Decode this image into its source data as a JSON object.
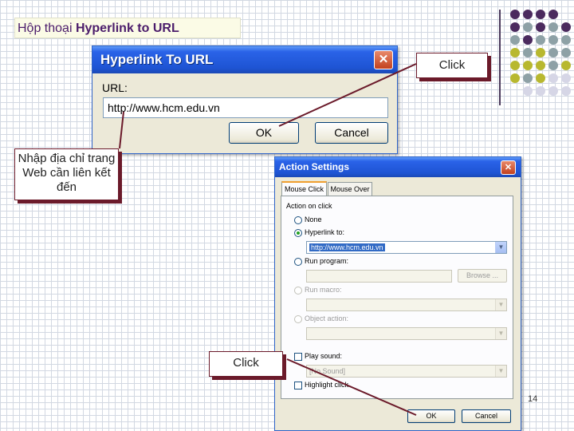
{
  "slide": {
    "title_prefix": "Hộp thoại ",
    "title_bold": "Hyperlink to URL",
    "page_number": "14"
  },
  "hyperlink_dialog": {
    "title": "Hyperlink To URL",
    "close_icon": "close-icon",
    "url_label": "URL:",
    "url_value": "http://www.hcm.edu.vn",
    "ok_label": "OK",
    "cancel_label": "Cancel"
  },
  "action_dialog": {
    "title": "Action Settings",
    "close_icon": "close-icon",
    "tabs": [
      {
        "label": "Mouse Click",
        "active": true
      },
      {
        "label": "Mouse Over",
        "active": false
      }
    ],
    "group_label": "Action on click",
    "options": {
      "none": "None",
      "hyperlink": "Hyperlink to:",
      "run_program": "Run program:",
      "run_macro": "Run macro:",
      "object_action": "Object action:"
    },
    "selected_option": "hyperlink",
    "hyperlink_value": "http://www.hcm.edu.vn",
    "browse_label": "Browse ...",
    "play_sound_label": "Play sound:",
    "sound_value": "[No Sound]",
    "highlight_click_label": "Highlight click",
    "ok_label": "OK",
    "cancel_label": "Cancel"
  },
  "callouts": {
    "click_top": "Click",
    "click_bottom": "Click",
    "enter_address": "Nhập địa chỉ trang Web cần liên kết đến"
  },
  "colors": {
    "accent_purple": "#4b2a5e",
    "accent_olive": "#b8b82f",
    "accent_gray": "#8ea1a6",
    "callout_border": "#6b1a2a",
    "xp_title_blue": "#1e54d3"
  }
}
